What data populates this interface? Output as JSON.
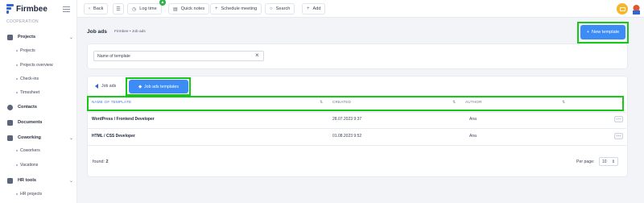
{
  "sidebar": {
    "logo_text": "Firmbee",
    "section_label": "COOPERATION",
    "items": [
      {
        "label": "Projects",
        "icon": "clipboard-icon"
      },
      {
        "label": "Contacts",
        "icon": "person-icon"
      },
      {
        "label": "Documents",
        "icon": "document-icon"
      },
      {
        "label": "Coworking",
        "icon": "people-icon"
      },
      {
        "label": "HR tools",
        "icon": "people-icon"
      }
    ],
    "projects_sub": [
      "Projects",
      "Projects overview",
      "Check-ins",
      "Timesheet"
    ],
    "coworking_sub": [
      "Coworkers",
      "Vacations"
    ],
    "hr_sub": [
      "HR projects"
    ]
  },
  "topbar": {
    "back": "Back",
    "log_time": "Log time",
    "quick_notes": "Quick notes",
    "schedule_meeting": "Schedule meeting",
    "search": "Search",
    "add": "Add"
  },
  "page": {
    "title": "Job ads",
    "breadcrumb": "Firmbee  •  Job ads",
    "new_template": "New template"
  },
  "filter": {
    "search_value": "Name of template"
  },
  "tabs": {
    "back": "Job ads",
    "active": "Job ads templates"
  },
  "table": {
    "headers": [
      "NAME OF TEMPLATE",
      "CREATED",
      "AUTHOR"
    ],
    "rows": [
      {
        "name": "WordPress / Frontend Developer",
        "created": "28.07.2023 9:37",
        "author": "Ana"
      },
      {
        "name": "HTML / CSS Developer",
        "created": "01.08.2023 9:52",
        "author": "Ana"
      }
    ]
  },
  "footer": {
    "found_label": "found:",
    "found_count": "2",
    "per_page_label": "Per page:",
    "per_page_value": "10"
  },
  "colors": {
    "accent": "#3d8bf5",
    "highlight": "#17c917",
    "notification": "#f7b528"
  }
}
